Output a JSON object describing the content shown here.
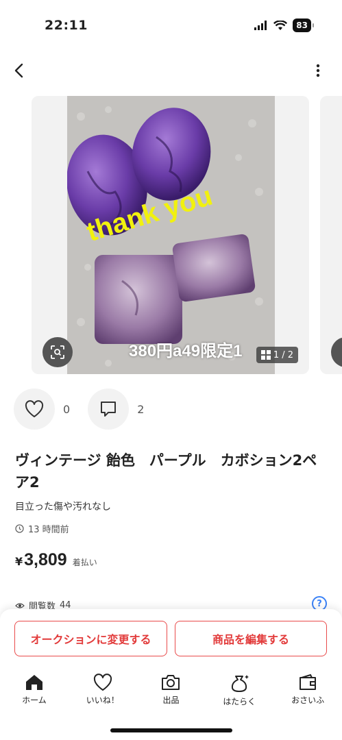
{
  "status_bar": {
    "time": "22:11",
    "battery": "83"
  },
  "carousel": {
    "overlay_text": "thank you",
    "overlay_caption": "380円a49限定1",
    "page_counter": "1 / 2"
  },
  "reactions": {
    "likes": "0",
    "comments": "2"
  },
  "item": {
    "title": "ヴィンテージ 飴色　パープル　カボション2ペア2",
    "description": "目立った傷や汚れなし",
    "posted": "13 時間前",
    "price_symbol": "¥",
    "price": "3,809",
    "shipping": "着払い",
    "views_label": "閲覧数",
    "views": "44"
  },
  "actions": {
    "auction_label": "オークションに変更する",
    "edit_label": "商品を編集する"
  },
  "tabs": [
    {
      "label": "ホーム",
      "icon": "home-icon"
    },
    {
      "label": "いいね！",
      "icon": "heart-icon"
    },
    {
      "label": "出品",
      "icon": "camera-icon"
    },
    {
      "label": "はたらく",
      "icon": "money-bag-icon"
    },
    {
      "label": "おさいふ",
      "icon": "wallet-icon"
    }
  ],
  "colors": {
    "accent": "#e94a4a",
    "help": "#3b82f6",
    "overlay_text": "#f1f10f"
  }
}
